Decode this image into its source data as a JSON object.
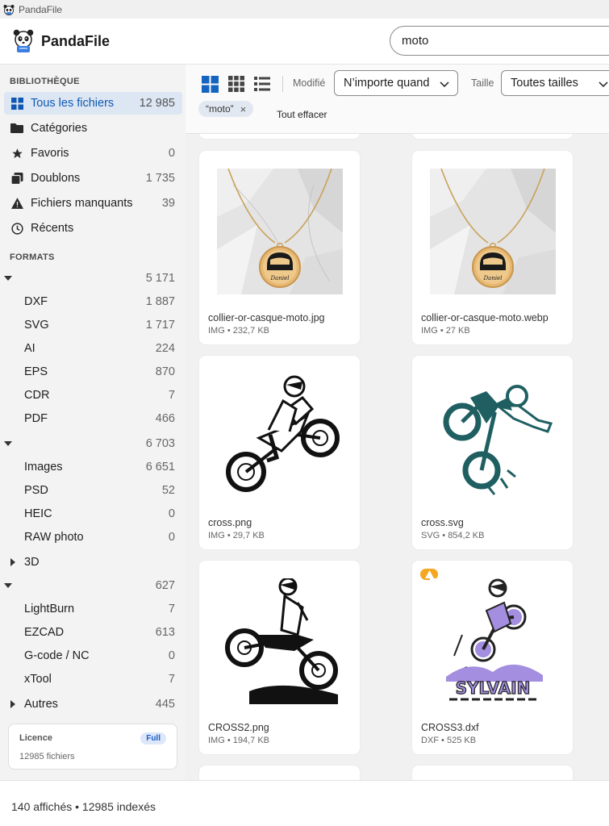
{
  "window": {
    "title": "PandaFile"
  },
  "header": {
    "brand": "PandaFile",
    "search_value": "moto"
  },
  "sidebar": {
    "library_title": "BIBLIOTHÈQUE",
    "library": [
      {
        "label": "Tous les fichiers",
        "count": "12 985",
        "icon": "grid-icon"
      },
      {
        "label": "Catégories",
        "count": "",
        "icon": "folder-icon"
      },
      {
        "label": "Favoris",
        "count": "0",
        "icon": "star-icon"
      },
      {
        "label": "Doublons",
        "count": "1 735",
        "icon": "duplicate-icon"
      },
      {
        "label": "Fichiers manquants",
        "count": "39",
        "icon": "warning-icon"
      },
      {
        "label": "Récents",
        "count": "",
        "icon": "clock-icon"
      }
    ],
    "formats_title": "FORMATS",
    "formats": [
      {
        "type": "group",
        "label": "",
        "count": "5 171",
        "expanded": true
      },
      {
        "type": "item",
        "label": "DXF",
        "count": "1 887"
      },
      {
        "type": "item",
        "label": "SVG",
        "count": "1 717"
      },
      {
        "type": "item",
        "label": "AI",
        "count": "224"
      },
      {
        "type": "item",
        "label": "EPS",
        "count": "870"
      },
      {
        "type": "item",
        "label": "CDR",
        "count": "7"
      },
      {
        "type": "item",
        "label": "PDF",
        "count": "466"
      },
      {
        "type": "group",
        "label": "",
        "count": "6 703",
        "expanded": true
      },
      {
        "type": "item",
        "label": "Images",
        "count": "6 651"
      },
      {
        "type": "item",
        "label": "PSD",
        "count": "52"
      },
      {
        "type": "item",
        "label": "HEIC",
        "count": "0"
      },
      {
        "type": "item",
        "label": "RAW photo",
        "count": "0"
      },
      {
        "type": "group",
        "label": "3D",
        "count": "",
        "expanded": false
      },
      {
        "type": "group",
        "label": "",
        "count": "627",
        "expanded": true
      },
      {
        "type": "item",
        "label": "LightBurn",
        "count": "7"
      },
      {
        "type": "item",
        "label": "EZCAD",
        "count": "613"
      },
      {
        "type": "item",
        "label": "G-code / NC",
        "count": "0"
      },
      {
        "type": "item",
        "label": "xTool",
        "count": "7"
      },
      {
        "type": "group",
        "label": "Autres",
        "count": "445",
        "expanded": false
      }
    ],
    "licence": {
      "title": "Licence",
      "badge": "Full",
      "files": "12985 fichiers"
    }
  },
  "toolbar": {
    "modified_label": "Modifié",
    "modified_value": "N’importe quand",
    "size_label": "Taille",
    "size_value": "Toutes tailles",
    "chip": "“moto”",
    "clear_all": "Tout effacer"
  },
  "files": [
    {
      "name": "collier-or-casque-moto.jpg",
      "meta": "IMG • 232,7 KB",
      "thumb": "necklace",
      "warning": false
    },
    {
      "name": "collier-or-casque-moto.webp",
      "meta": "IMG • 27 KB",
      "thumb": "necklace",
      "warning": false
    },
    {
      "name": "cross.png",
      "meta": "IMG • 29,7 KB",
      "thumb": "moto-black-1",
      "warning": false
    },
    {
      "name": "cross.svg",
      "meta": "SVG • 854,2 KB",
      "thumb": "moto-teal",
      "warning": false
    },
    {
      "name": "CROSS2.png",
      "meta": "IMG • 194,7 KB",
      "thumb": "moto-black-2",
      "warning": false
    },
    {
      "name": "CROSS3.dxf",
      "meta": "DXF • 525 KB",
      "thumb": "moto-purple",
      "warning": true,
      "thumb_text": "SYLVAIN"
    }
  ],
  "colors": {
    "accent": "#1565c0",
    "warning": "#f5a623",
    "teal": "#1f5f62",
    "purple": "#a48ee0"
  },
  "status": {
    "text": "140 affichés • 12985 indexés"
  }
}
